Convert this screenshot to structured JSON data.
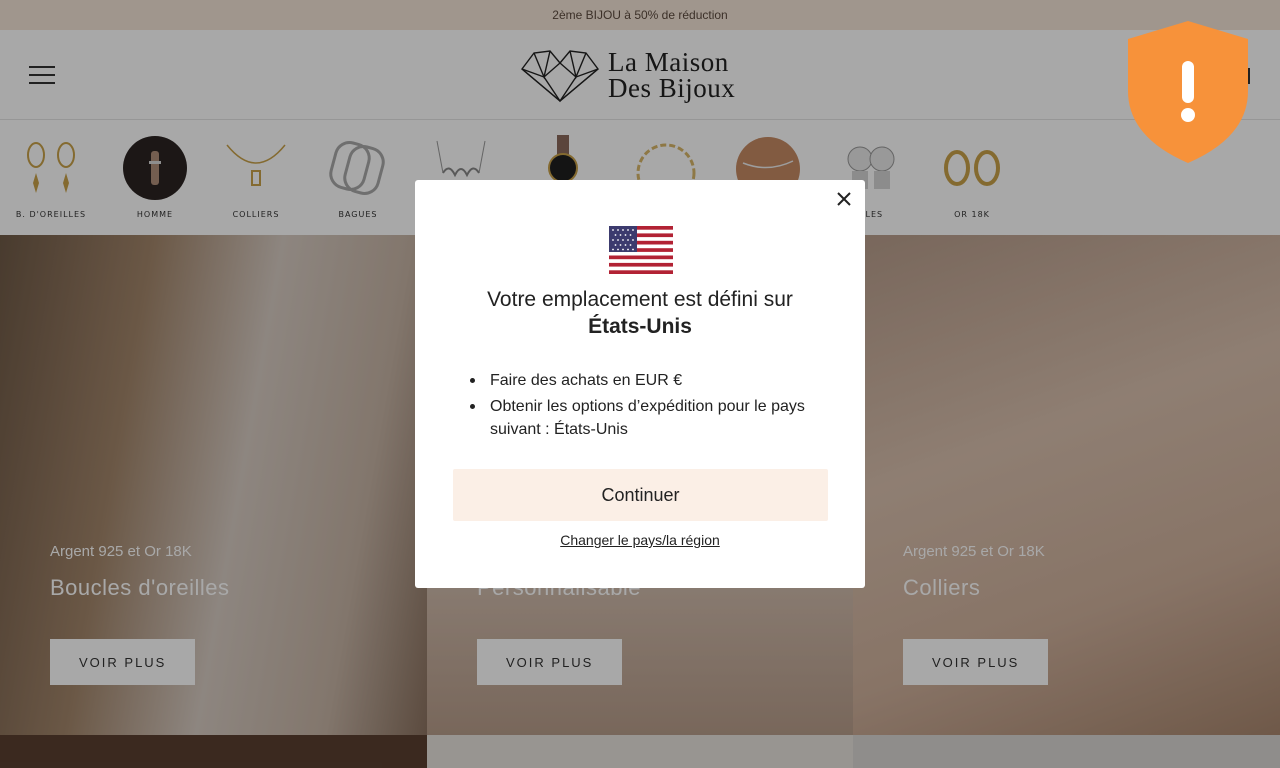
{
  "announcement": "2ème BIJOU à 50% de réduction",
  "header": {
    "logo_line1": "La Maison",
    "logo_line2": "Des Bijoux"
  },
  "categories": [
    {
      "label": "B. D'OREILLES",
      "icon": "gold-earrings"
    },
    {
      "label": "HOMME",
      "icon": "bracelet-wrist"
    },
    {
      "label": "COLLIERS",
      "icon": "gold-necklace"
    },
    {
      "label": "BAGUES",
      "icon": "silver-rings"
    },
    {
      "label": "",
      "icon": "name-necklace"
    },
    {
      "label": "",
      "icon": "watch"
    },
    {
      "label": "",
      "icon": "gold-chain-bracelet"
    },
    {
      "label": "",
      "icon": "anklet"
    },
    {
      "label": "RLES",
      "icon": "charm-beads"
    },
    {
      "label": "OR 18K",
      "icon": "gold-hoops"
    }
  ],
  "banners": [
    {
      "subtitle": "Argent 925 et Or 18K",
      "title": "Boucles d'oreilles",
      "button": "VOIR PLUS"
    },
    {
      "subtitle": "",
      "title": "Personnalisable",
      "button": "VOIR PLUS"
    },
    {
      "subtitle": "Argent 925 et Or 18K",
      "title": "Colliers",
      "button": "VOIR PLUS"
    }
  ],
  "modal": {
    "line1": "Votre emplacement est défini sur",
    "country": "États-Unis",
    "items": [
      "Faire des achats en EUR €",
      "Obtenir les options d’expédition pour le pays suivant : États-Unis"
    ],
    "continue_label": "Continuer",
    "change_label": "Changer le pays/la région"
  },
  "colors": {
    "announcement_bg": "#f3e4d7",
    "continue_bg": "#fbefe6",
    "shield": "#f7923a"
  }
}
